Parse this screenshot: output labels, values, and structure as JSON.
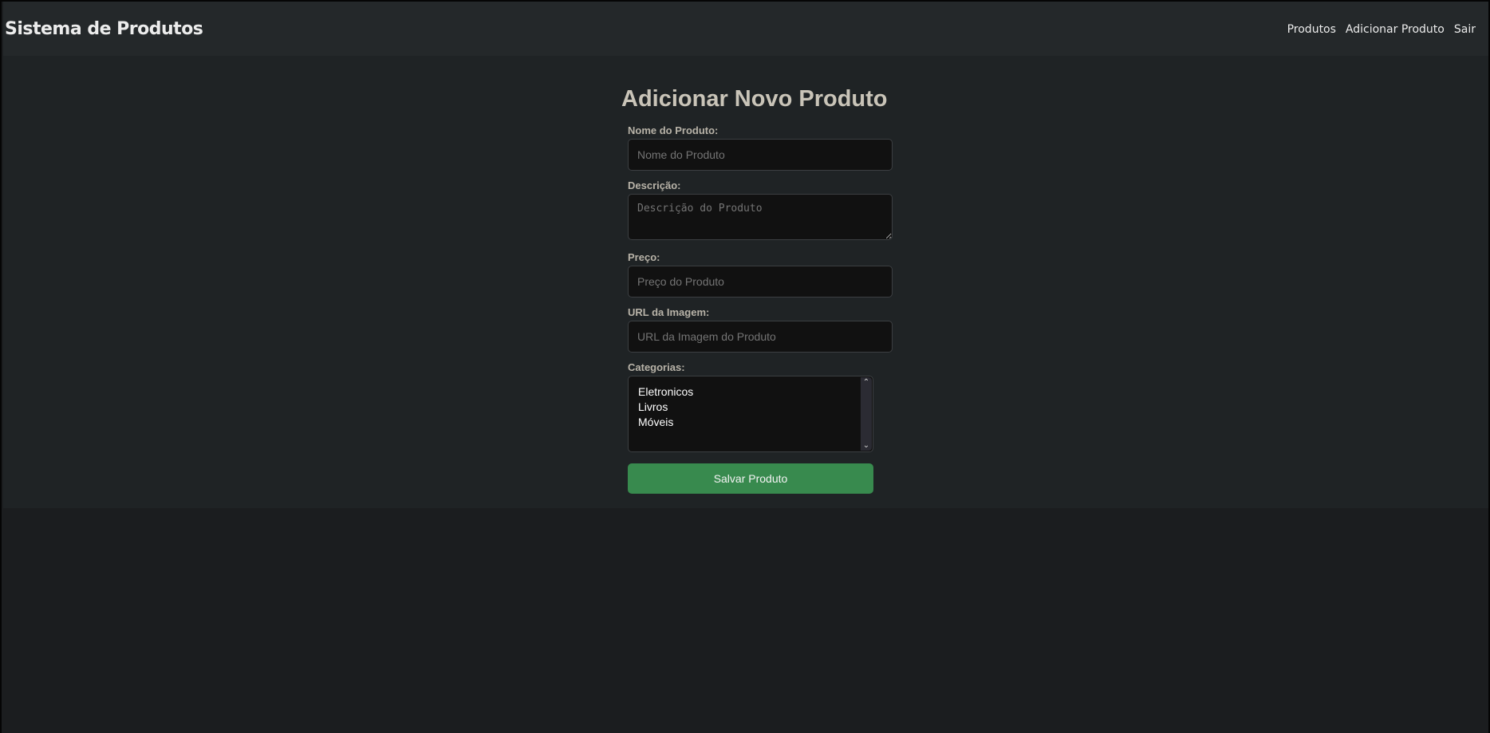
{
  "navbar": {
    "brand": "Sistema de Produtos",
    "links": [
      {
        "label": "Produtos"
      },
      {
        "label": "Adicionar Produto"
      },
      {
        "label": "Sair"
      }
    ]
  },
  "form": {
    "title": "Adicionar Novo Produto",
    "name": {
      "label": "Nome do Produto:",
      "placeholder": "Nome do Produto",
      "value": ""
    },
    "description": {
      "label": "Descrição:",
      "placeholder": "Descrição do Produto",
      "value": ""
    },
    "price": {
      "label": "Preço:",
      "placeholder": "Preço do Produto",
      "value": ""
    },
    "image_url": {
      "label": "URL da Imagem:",
      "placeholder": "URL da Imagem do Produto",
      "value": ""
    },
    "categories": {
      "label": "Categorias:",
      "options": [
        "Eletronicos",
        "Livros",
        "Móveis"
      ]
    },
    "submit_label": "Salvar Produto"
  },
  "colors": {
    "navbar_bg": "#24282a",
    "main_bg": "#1f2325",
    "page_bg": "#1b1d1f",
    "button_bg": "#388a4e",
    "input_bg": "#111111"
  },
  "icons": {
    "scroll_up": "chevron-up-icon",
    "scroll_down": "chevron-down-icon"
  }
}
